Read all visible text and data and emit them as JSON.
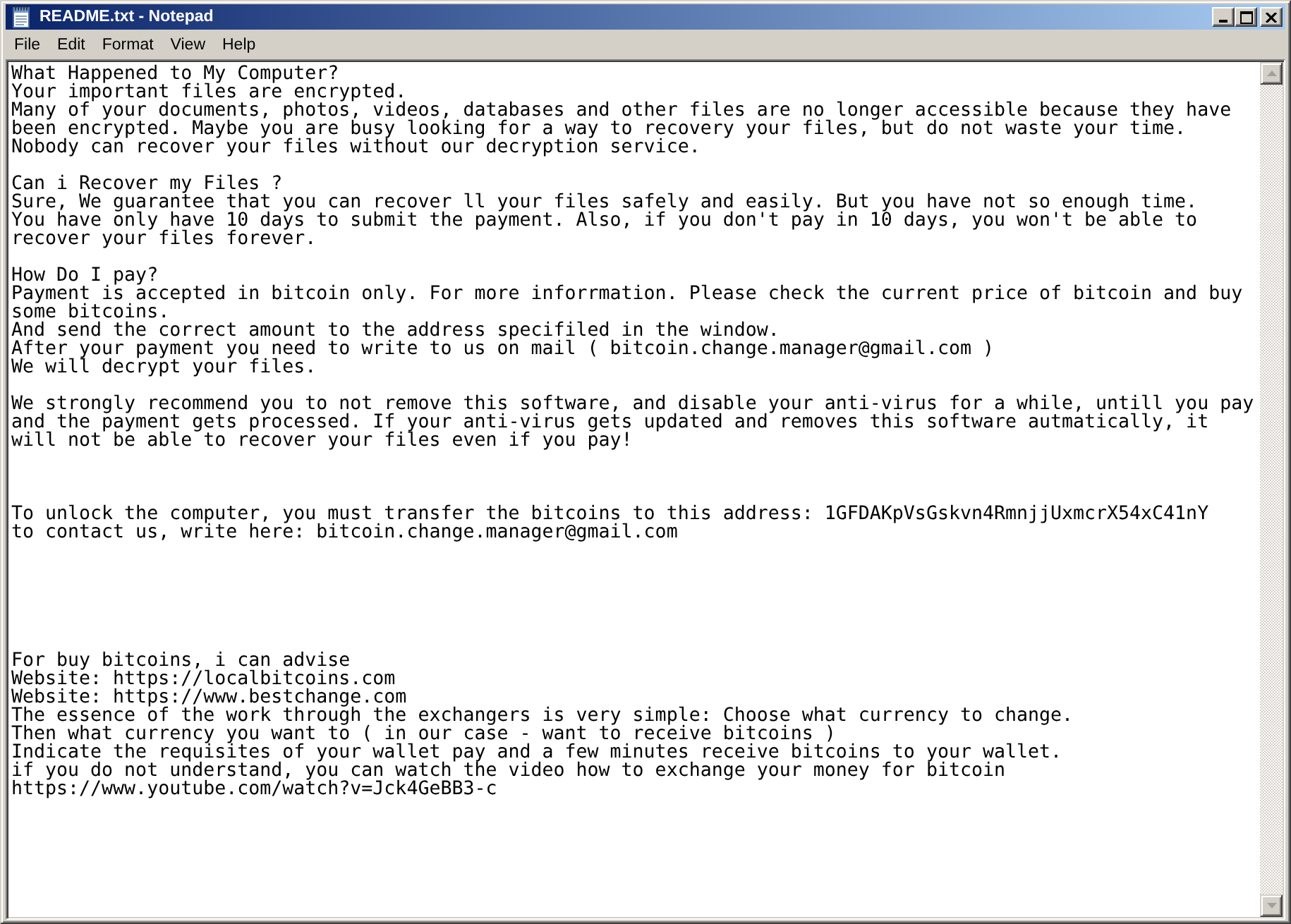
{
  "window": {
    "title": "README.txt - Notepad"
  },
  "menu": [
    "File",
    "Edit",
    "Format",
    "View",
    "Help"
  ],
  "editor": {
    "lines": [
      {
        "kind": "text",
        "text": "What Happened to My Computer?"
      },
      {
        "kind": "text",
        "text": "Your important files are encrypted."
      },
      {
        "kind": "text",
        "text": "Many of your documents, photos, videos, databases and other files are no longer accessible because they have"
      },
      {
        "kind": "text",
        "text": "been encrypted. Maybe you are busy looking for a way to recovery your files, but do not waste your time."
      },
      {
        "kind": "text",
        "text": "Nobody can recover your files without our decryption service."
      },
      {
        "kind": "blank"
      },
      {
        "kind": "text",
        "text": "Can i Recover my Files ?"
      },
      {
        "kind": "text",
        "text": "Sure, We guarantee that you can recover ll your files safely and easily. But you have not so enough time."
      },
      {
        "kind": "text",
        "text": "You have only have 10 days to submit the payment. Also, if you don't pay in 10 days, you won't be able to"
      },
      {
        "kind": "text",
        "text": "recover your files forever."
      },
      {
        "kind": "blank"
      },
      {
        "kind": "text",
        "text": "How Do I pay?"
      },
      {
        "kind": "text",
        "text": "Payment is accepted in bitcoin only. For more inforrmation. Please check the current price of bitcoin and buy"
      },
      {
        "kind": "text",
        "text": "some bitcoins."
      },
      {
        "kind": "text",
        "text": "And send the correct amount to the address specifiled in the window."
      },
      {
        "kind": "text",
        "text": "After your payment you need to write to us on mail ( bitcoin.change.manager@gmail.com )"
      },
      {
        "kind": "text",
        "text": "We will decrypt your files."
      },
      {
        "kind": "blank"
      },
      {
        "kind": "text",
        "text": "We strongly recommend you to not remove this software, and disable your anti-virus for a while, untill you pay"
      },
      {
        "kind": "text",
        "text": "and the payment gets processed. If your anti-virus gets updated and removes this software autmatically, it"
      },
      {
        "kind": "text",
        "text": "will not be able to recover your files even if you pay!"
      },
      {
        "kind": "blank"
      },
      {
        "kind": "blank"
      },
      {
        "kind": "blank"
      },
      {
        "kind": "text",
        "text": "To unlock the computer, you must transfer the bitcoins to this address: 1GFDAKpVsGskvn4RmnjjUxmcrX54xC41nY"
      },
      {
        "kind": "text",
        "text": "to contact us, write here: bitcoin.change.manager@gmail.com"
      },
      {
        "kind": "blank"
      },
      {
        "kind": "blank"
      },
      {
        "kind": "blank"
      },
      {
        "kind": "blank"
      },
      {
        "kind": "blank"
      },
      {
        "kind": "blank"
      },
      {
        "kind": "text",
        "text": "For buy bitcoins, i can advise"
      },
      {
        "kind": "text",
        "text": "Website: https://localbitcoins.com"
      },
      {
        "kind": "text",
        "text": "Website: https://www.bestchange.com"
      },
      {
        "kind": "text",
        "text": "The essence of the work through the exchangers is very simple: Choose what currency to change."
      },
      {
        "kind": "text",
        "text": "Then what currency you want to ( in our case - want to receive bitcoins )"
      },
      {
        "kind": "text",
        "text": "Indicate the requisites of your wallet pay and a few minutes receive bitcoins to your wallet."
      },
      {
        "kind": "text",
        "text": "if you do not understand, you can watch the video how to exchange your money for bitcoin"
      },
      {
        "kind": "text",
        "text": "https://www.youtube.com/watch?v=Jck4GeBB3-c"
      }
    ]
  }
}
